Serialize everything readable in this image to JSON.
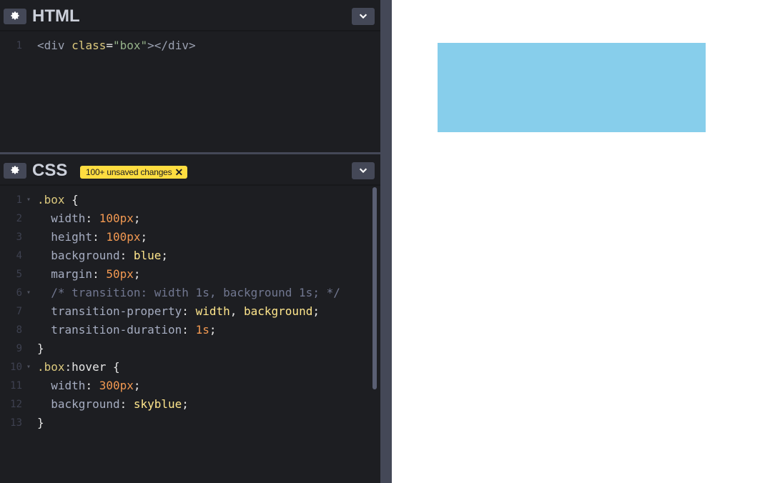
{
  "html_panel": {
    "title": "HTML",
    "lines": [
      {
        "num": "1",
        "parts": [
          {
            "t": "<div ",
            "c": "tag"
          },
          {
            "t": "class",
            "c": "attr"
          },
          {
            "t": "=",
            "c": "punc"
          },
          {
            "t": "\"box\"",
            "c": "str2"
          },
          {
            "t": "></div>",
            "c": "tag"
          }
        ]
      }
    ]
  },
  "css_panel": {
    "title": "CSS",
    "unsaved_badge": "100+ unsaved changes",
    "lines": [
      {
        "num": "1",
        "fold": true,
        "parts": [
          {
            "t": ".box",
            "c": "sel"
          },
          {
            "t": " {",
            "c": "punc"
          }
        ]
      },
      {
        "num": "2",
        "parts": [
          {
            "t": "  width",
            "c": "prop"
          },
          {
            "t": ": ",
            "c": "punc"
          },
          {
            "t": "100px",
            "c": "num"
          },
          {
            "t": ";",
            "c": "punc"
          }
        ]
      },
      {
        "num": "3",
        "parts": [
          {
            "t": "  height",
            "c": "prop"
          },
          {
            "t": ": ",
            "c": "punc"
          },
          {
            "t": "100px",
            "c": "num"
          },
          {
            "t": ";",
            "c": "punc"
          }
        ]
      },
      {
        "num": "4",
        "parts": [
          {
            "t": "  background",
            "c": "prop"
          },
          {
            "t": ": ",
            "c": "punc"
          },
          {
            "t": "blue",
            "c": "kw"
          },
          {
            "t": ";",
            "c": "punc"
          }
        ]
      },
      {
        "num": "5",
        "parts": [
          {
            "t": "  margin",
            "c": "prop"
          },
          {
            "t": ": ",
            "c": "punc"
          },
          {
            "t": "50px",
            "c": "num"
          },
          {
            "t": ";",
            "c": "punc"
          }
        ]
      },
      {
        "num": "6",
        "fold": true,
        "parts": [
          {
            "t": "  /* transition: width 1s, background 1s; */",
            "c": "comment"
          }
        ]
      },
      {
        "num": "7",
        "parts": [
          {
            "t": "  transition-property",
            "c": "prop"
          },
          {
            "t": ": ",
            "c": "punc"
          },
          {
            "t": "width",
            "c": "kw"
          },
          {
            "t": ", ",
            "c": "punc"
          },
          {
            "t": "background",
            "c": "kw"
          },
          {
            "t": ";",
            "c": "punc"
          }
        ]
      },
      {
        "num": "8",
        "parts": [
          {
            "t": "  transition-duration",
            "c": "prop"
          },
          {
            "t": ": ",
            "c": "punc"
          },
          {
            "t": "1s",
            "c": "num"
          },
          {
            "t": ";",
            "c": "punc"
          }
        ]
      },
      {
        "num": "9",
        "parts": [
          {
            "t": "}",
            "c": "punc"
          }
        ]
      },
      {
        "num": "10",
        "fold": true,
        "parts": [
          {
            "t": ".box",
            "c": "sel"
          },
          {
            "t": ":hover",
            "c": "punc"
          },
          {
            "t": " {",
            "c": "punc"
          }
        ]
      },
      {
        "num": "11",
        "parts": [
          {
            "t": "  width",
            "c": "prop"
          },
          {
            "t": ": ",
            "c": "punc"
          },
          {
            "t": "300px",
            "c": "num"
          },
          {
            "t": ";",
            "c": "punc"
          }
        ]
      },
      {
        "num": "12",
        "parts": [
          {
            "t": "  background",
            "c": "prop"
          },
          {
            "t": ": ",
            "c": "punc"
          },
          {
            "t": "skyblue",
            "c": "kw"
          },
          {
            "t": ";",
            "c": "punc"
          }
        ]
      },
      {
        "num": "13",
        "parts": [
          {
            "t": "}",
            "c": "punc"
          }
        ]
      }
    ]
  },
  "icons": {
    "settings": "gear-icon",
    "collapse": "chevron-down-icon",
    "dismiss": "close-icon"
  },
  "preview": {
    "box_color": "#87ceeb"
  }
}
